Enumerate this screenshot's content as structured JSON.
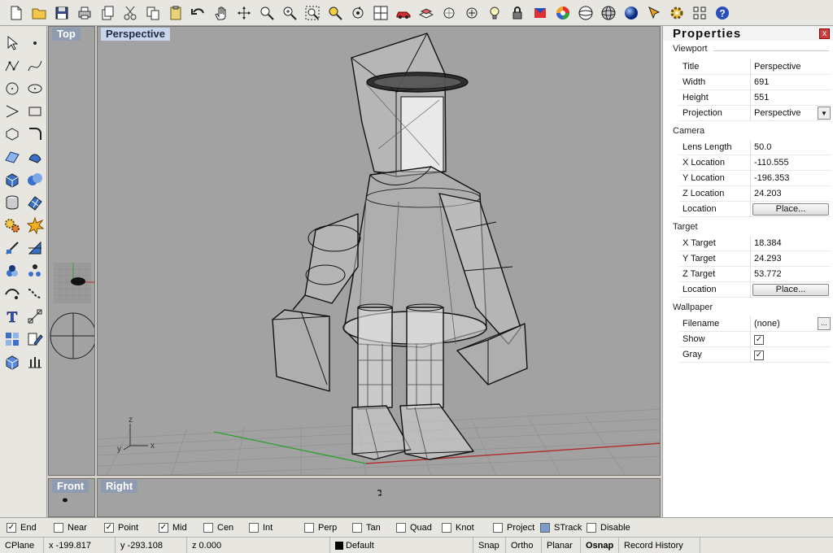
{
  "toolbar": {
    "icons": [
      "new-file-icon",
      "open-folder-icon",
      "save-icon",
      "print-icon",
      "copy-to-clipboard-icon",
      "cut-icon",
      "copy-icon",
      "paste-icon",
      "undo-icon",
      "pan-hand-icon",
      "rotate-view-icon",
      "zoom-window-icon",
      "zoom-dynamic-icon",
      "zoom-extents-icon",
      "zoom-selected-icon",
      "rotate-camera-icon",
      "four-viewports-icon",
      "car-render-icon",
      "layers-icon",
      "cplane-icon",
      "object-properties-icon",
      "light-bulb-icon",
      "lock-icon",
      "materials-icon",
      "color-wheel-icon",
      "wireframe-sphere-icon",
      "ghosted-sphere-icon",
      "shaded-sphere-icon",
      "tip-arrow-icon",
      "gear-icon",
      "grid-tools-icon",
      "help-icon"
    ]
  },
  "viewports": {
    "top": {
      "title": "Top"
    },
    "perspective": {
      "title": "Perspective"
    },
    "front": {
      "title": "Front"
    },
    "right": {
      "title": "Right"
    }
  },
  "axis_labels": {
    "z": "z",
    "x": "x",
    "y": "y"
  },
  "properties": {
    "title": "Properties",
    "close": "x",
    "sections": {
      "viewport": "Viewport",
      "camera": "Camera",
      "target": "Target",
      "wallpaper": "Wallpaper"
    },
    "viewport": {
      "title_label": "Title",
      "title_value": "Perspective",
      "width_label": "Width",
      "width_value": "691",
      "height_label": "Height",
      "height_value": "551",
      "projection_label": "Projection",
      "projection_value": "Perspective"
    },
    "camera": {
      "lens_label": "Lens Length",
      "lens_value": "50.0",
      "x_label": "X Location",
      "x_value": "-110.555",
      "y_label": "Y Location",
      "y_value": "-196.353",
      "z_label": "Z Location",
      "z_value": "24.203",
      "location_label": "Location",
      "location_button": "Place..."
    },
    "target": {
      "x_label": "X Target",
      "x_value": "18.384",
      "y_label": "Y Target",
      "y_value": "24.293",
      "z_label": "Z Target",
      "z_value": "53.772",
      "location_label": "Location",
      "location_button": "Place..."
    },
    "wallpaper": {
      "filename_label": "Filename",
      "filename_value": "(none)",
      "browse": "...",
      "show_label": "Show",
      "gray_label": "Gray"
    }
  },
  "osnap": [
    {
      "label": "End",
      "checked": true
    },
    {
      "label": "Near",
      "checked": false
    },
    {
      "label": "Point",
      "checked": true
    },
    {
      "label": "Mid",
      "checked": true
    },
    {
      "label": "Cen",
      "checked": false
    },
    {
      "label": "Int",
      "checked": false
    },
    {
      "label": "Perp",
      "checked": false
    },
    {
      "label": "Tan",
      "checked": false
    },
    {
      "label": "Quad",
      "checked": false
    },
    {
      "label": "Knot",
      "checked": false
    },
    {
      "label": "Project",
      "checked": false
    },
    {
      "label": "STrack",
      "checked": false
    },
    {
      "label": "Disable",
      "checked": false
    }
  ],
  "status": {
    "cplane": "CPlane",
    "x": "x -199.817",
    "y": "y -293.108",
    "z": "z 0.000",
    "layer": "Default",
    "layer_color": "#000000",
    "snap": "Snap",
    "ortho": "Ortho",
    "planar": "Planar",
    "osnap": "Osnap",
    "history": "Record History"
  },
  "colors": {
    "viewport_bg": "#a2a2a2",
    "grid": "#8a8a8a",
    "x_axis": "#b03030",
    "y_axis": "#30a030",
    "wire": "#111111"
  }
}
